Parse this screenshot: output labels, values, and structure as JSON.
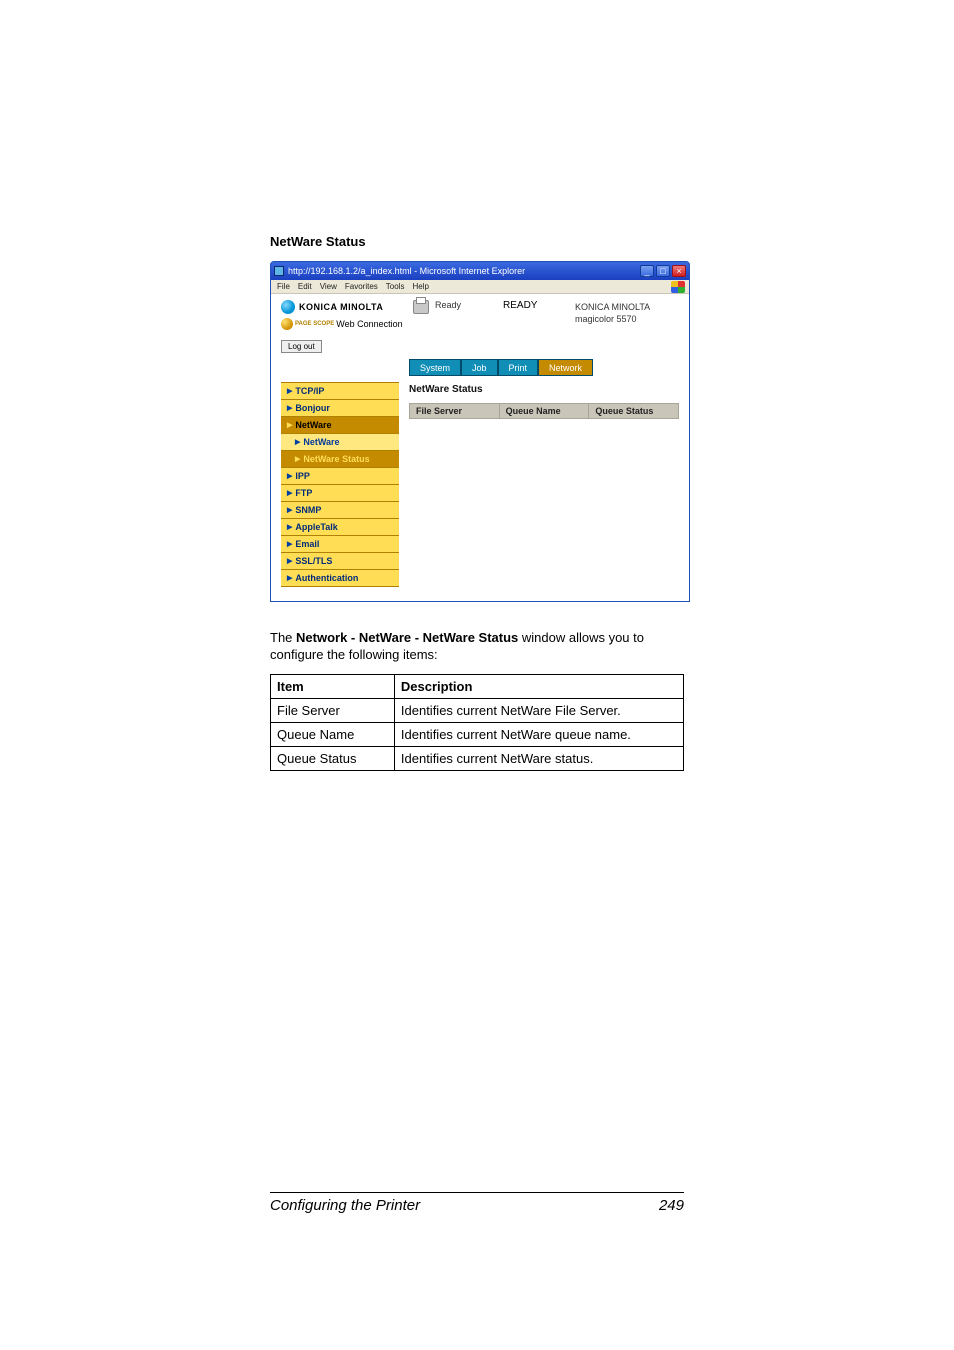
{
  "heading": "NetWare Status",
  "ie": {
    "title": "http://192.168.1.2/a_index.html - Microsoft Internet Explorer",
    "menus": [
      "File",
      "Edit",
      "View",
      "Favorites",
      "Tools",
      "Help"
    ],
    "brand": "KONICA MINOLTA",
    "pagescope_small": "PAGE SCOPE",
    "pagescope_label": "Web Connection",
    "ready_label": "Ready",
    "ready_big": "READY",
    "model_line1": "KONICA MINOLTA",
    "model_line2": "magicolor 5570",
    "logout": "Log out",
    "tabs": {
      "system": "System",
      "job": "Job",
      "print": "Print",
      "network": "Network"
    },
    "sidebar": {
      "tcpip": "TCP/IP",
      "bonjour": "Bonjour",
      "netware": "NetWare",
      "netware_sub": "NetWare",
      "netware_status": "NetWare Status",
      "ipp": "IPP",
      "ftp": "FTP",
      "snmp": "SNMP",
      "appletalk": "AppleTalk",
      "email": "Email",
      "ssltls": "SSL/TLS",
      "auth": "Authentication"
    },
    "pane_title": "NetWare Status",
    "cols": {
      "file_server": "File Server",
      "queue_name": "Queue Name",
      "queue_status": "Queue Status"
    }
  },
  "para_prefix": "The ",
  "para_bold": "Network - NetWare - NetWare Status",
  "para_suffix": " window allows you to configure the following items:",
  "table": {
    "h_item": "Item",
    "h_desc": "Description",
    "rows": [
      {
        "item": "File Server",
        "desc": "Identifies current NetWare File Server."
      },
      {
        "item": "Queue Name",
        "desc": "Identifies current NetWare queue name."
      },
      {
        "item": "Queue Status",
        "desc": "Identifies current NetWare status."
      }
    ]
  },
  "footer": {
    "title": "Configuring the Printer",
    "page": "249"
  }
}
